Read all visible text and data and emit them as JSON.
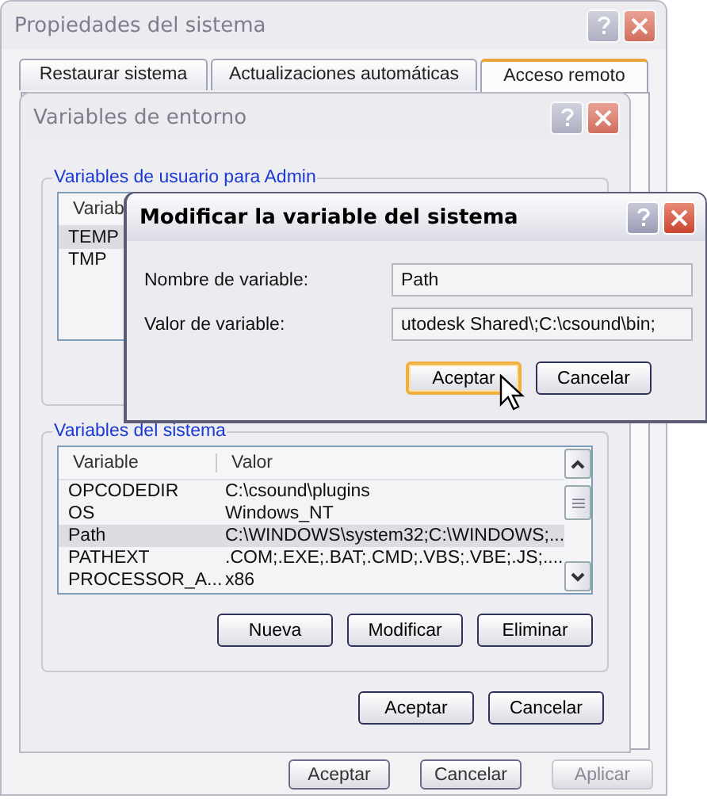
{
  "system_properties": {
    "title": "Propiedades del sistema",
    "active": false,
    "tabs": [
      {
        "label": "Restaurar sistema",
        "selected": false
      },
      {
        "label": "Actualizaciones automáticas",
        "selected": false
      },
      {
        "label": "Acceso remoto",
        "selected": true
      }
    ],
    "buttons": [
      {
        "label": "Aceptar",
        "disabled": false
      },
      {
        "label": "Cancelar",
        "disabled": false
      },
      {
        "label": "Aplicar",
        "disabled": true
      }
    ]
  },
  "environment_variables": {
    "title": "Variables de entorno",
    "active": false,
    "user_group": {
      "title": "Variables de usuario para Admin",
      "columns": [
        "Variab"
      ],
      "rows": [
        {
          "variable": "TEMP",
          "selected": true
        },
        {
          "variable": "TMP",
          "selected": false
        }
      ]
    },
    "system_group": {
      "title": "Variables del sistema",
      "columns": [
        "Variable",
        "Valor"
      ],
      "rows": [
        {
          "variable": "OPCODEDIR",
          "value": "C:\\csound\\plugins",
          "selected": false
        },
        {
          "variable": "OS",
          "value": "Windows_NT",
          "selected": false
        },
        {
          "variable": "Path",
          "value": "C:\\WINDOWS\\system32;C:\\WINDOWS;...",
          "selected": true
        },
        {
          "variable": "PATHEXT",
          "value": ".COM;.EXE;.BAT;.CMD;.VBS;.VBE;.JS;....",
          "selected": false
        },
        {
          "variable": "PROCESSOR_A...",
          "value": "x86",
          "selected": false
        }
      ],
      "buttons": [
        "Nueva",
        "Modificar",
        "Eliminar"
      ]
    },
    "buttons": [
      "Aceptar",
      "Cancelar"
    ]
  },
  "edit_dialog": {
    "title": "Modificar la variable del sistema",
    "active": true,
    "fields": [
      {
        "label": "Nombre de variable:",
        "value": "Path"
      },
      {
        "label": "Valor de variable:",
        "value": "utodesk Shared\\;C:\\csound\\bin;"
      }
    ],
    "buttons": [
      {
        "label": "Aceptar",
        "focused": true
      },
      {
        "label": "Cancelar",
        "focused": false
      }
    ]
  }
}
